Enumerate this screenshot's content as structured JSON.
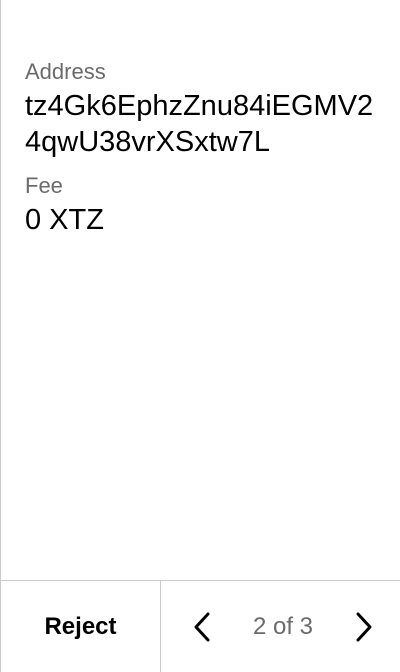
{
  "fields": {
    "address": {
      "label": "Address",
      "value": "tz4Gk6EphzZnu84iEGMV24qwU38vrXSxtw7L"
    },
    "fee": {
      "label": "Fee",
      "value": "0 XTZ"
    }
  },
  "footer": {
    "reject_label": "Reject",
    "page_status": "2 of 3",
    "prev_icon": "chevron-left-icon",
    "next_icon": "chevron-right-icon"
  }
}
